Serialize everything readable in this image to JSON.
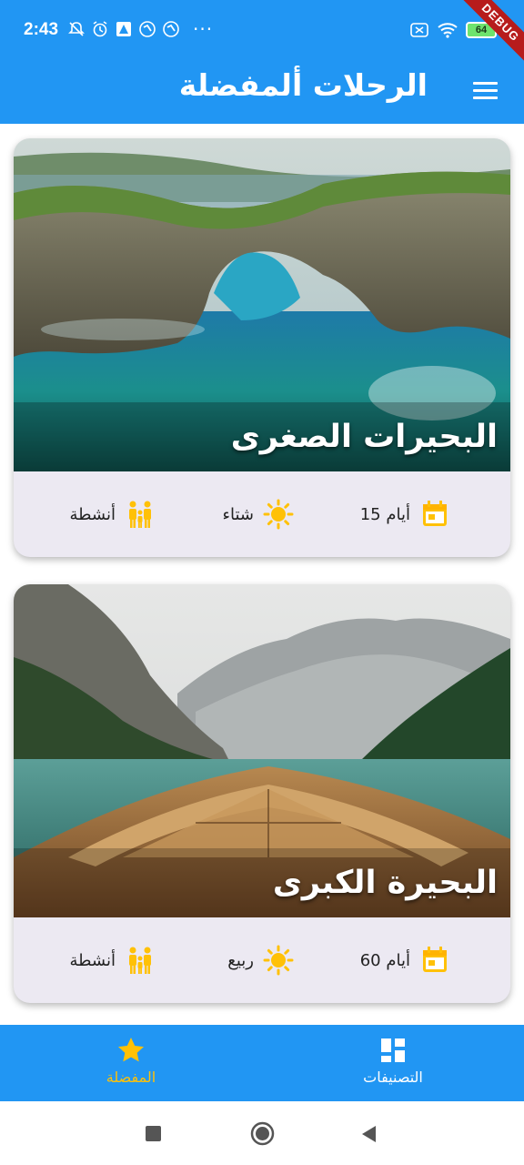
{
  "status_bar": {
    "time": "2:43",
    "dots": "···",
    "battery": "64",
    "debug_banner": "DEBUG"
  },
  "app_bar": {
    "title": "الرحلات ألمفضلة",
    "menu_icon": "hamburger-menu-icon"
  },
  "trips": [
    {
      "title": "البحيرات الصغرى",
      "duration": "15 أيام",
      "season": "شتاء",
      "activities": "أنشطة"
    },
    {
      "title": "البحيرة الكبرى",
      "duration": "60 أيام",
      "season": "ربيع",
      "activities": "أنشطة"
    }
  ],
  "bottom_nav": {
    "items": [
      {
        "label": "المفضلة",
        "icon": "star-icon",
        "active": true
      },
      {
        "label": "التصنيفات",
        "icon": "dashboard-icon",
        "active": false
      }
    ],
    "active_color": "#FFC107",
    "inactive_color": "#FFFFFF"
  },
  "colors": {
    "primary": "#2196F3",
    "accent": "#FFC107",
    "card_info_bg": "#ECE9F2"
  }
}
